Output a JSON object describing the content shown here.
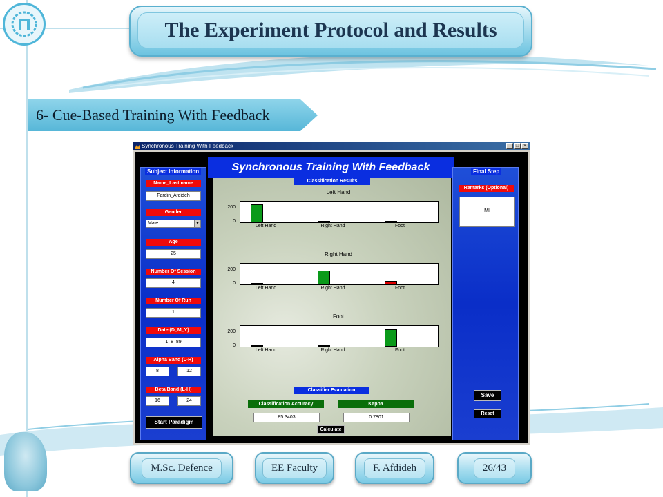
{
  "slide": {
    "title": "The Experiment Protocol and Results",
    "section": "6- Cue-Based Training With Feedback",
    "footer": {
      "left": "M.Sc. Defence",
      "center": "EE Faculty",
      "author": "F. Afdideh",
      "page": "26/43"
    },
    "colors": {
      "accent": "#57b7d8",
      "title_text": "#1c3550"
    }
  },
  "window": {
    "title": "Synchronous Training With Feedback",
    "controls": [
      "_",
      "□",
      "×"
    ],
    "header": "Synchronous Training With Feedback"
  },
  "subject": {
    "group_title": "Subject Information",
    "name_label": "Name_Last name",
    "name_value": "Fardin_Afdideh",
    "gender_label": "Gender",
    "gender_value": "Male",
    "age_label": "Age",
    "age_value": "25",
    "session_label": "Number Of Session",
    "session_value": "4",
    "run_label": "Number Of Run",
    "run_value": "1",
    "date_label": "Date (D_M_Y)",
    "date_value": "1_8_89",
    "alpha_label": "Alpha Band (L-H)",
    "alpha_low": "8",
    "alpha_high": "12",
    "beta_label": "Beta Band (L-H)",
    "beta_low": "16",
    "beta_high": "24",
    "start_button": "Start Paradigm"
  },
  "results": {
    "group_title": "Classification Results",
    "colors": {
      "correct": "#0a9a1a",
      "wrong": "#e00000"
    }
  },
  "chart_data": [
    {
      "type": "bar",
      "title": "Left Hand",
      "categories": [
        "Left Hand",
        "Right Hand",
        "Foot"
      ],
      "values": [
        290,
        20,
        15
      ],
      "yticks": [
        "0",
        "200"
      ],
      "ylim": [
        0,
        340
      ]
    },
    {
      "type": "bar",
      "title": "Right Hand",
      "categories": [
        "Left Hand",
        "Right Hand",
        "Foot"
      ],
      "values": [
        25,
        230,
        60
      ],
      "yticks": [
        "0",
        "200"
      ],
      "ylim": [
        0,
        340
      ]
    },
    {
      "type": "bar",
      "title": "Foot",
      "categories": [
        "Left Hand",
        "Right Hand",
        "Foot"
      ],
      "values": [
        20,
        20,
        285
      ],
      "yticks": [
        "0",
        "200"
      ],
      "ylim": [
        0,
        340
      ]
    }
  ],
  "evaluation": {
    "group_title": "Classifier Evaluation",
    "accuracy_label": "Classification Accuracy",
    "accuracy_value": "85.3403",
    "kappa_label": "Kappa",
    "kappa_value": "0.7801",
    "calculate_button": "Calculate"
  },
  "final": {
    "group_title": "Final Step",
    "remarks_label": "Remarks (Optional)",
    "remarks_value": "MI",
    "save_button": "Save",
    "reset_button": "Reset"
  }
}
